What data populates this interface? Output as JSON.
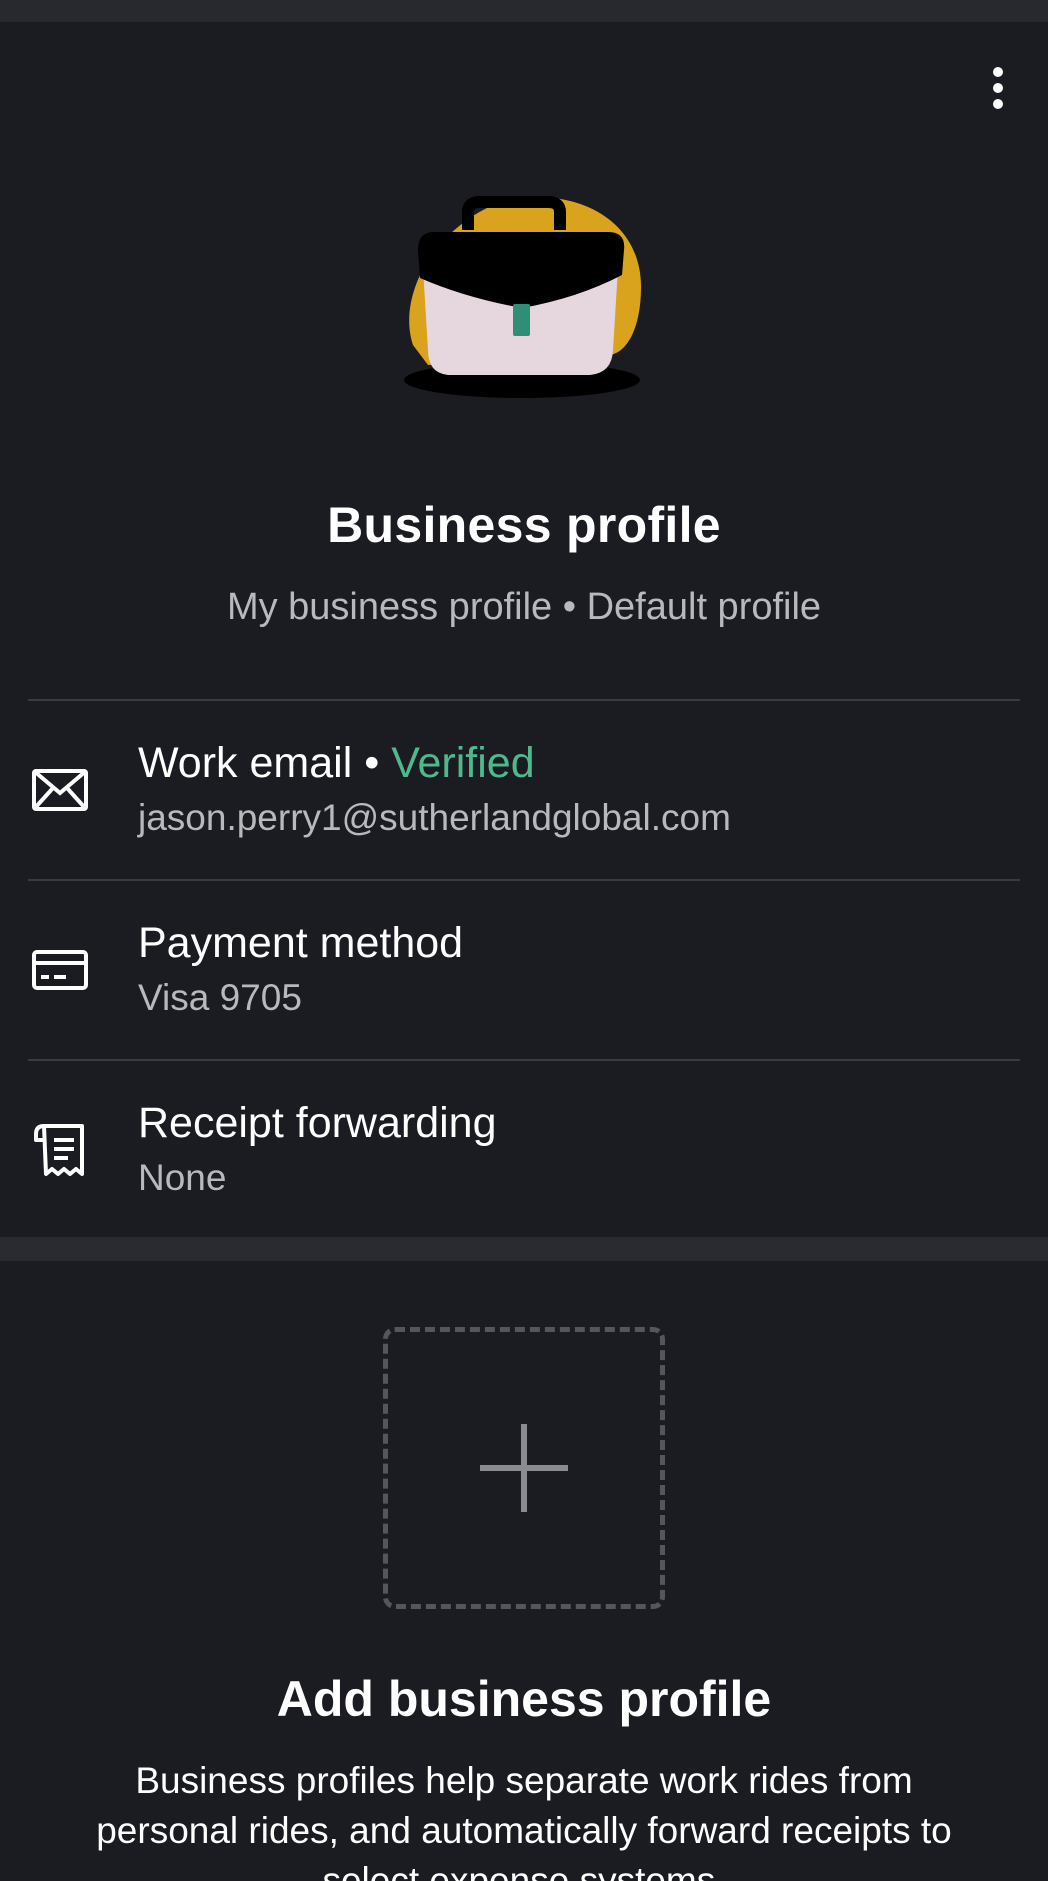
{
  "header": {
    "more_icon": "more-vertical-icon"
  },
  "profile": {
    "illustration": "briefcase-illustration",
    "title": "Business profile",
    "subtitle": "My business profile • Default profile"
  },
  "rows": [
    {
      "icon": "envelope-icon",
      "title": "Work email",
      "separator": " • ",
      "badge": "Verified",
      "value": "jason.perry1@sutherlandglobal.com"
    },
    {
      "icon": "credit-card-icon",
      "title": "Payment method",
      "value": "Visa 9705"
    },
    {
      "icon": "receipt-icon",
      "title": "Receipt forwarding",
      "value": "None"
    }
  ],
  "add_profile": {
    "icon": "plus-icon",
    "title": "Add business profile",
    "description": "Business profiles help separate work rides from personal rides, and automatically forward receipts to select expense systems."
  },
  "colors": {
    "background": "#1b1c21",
    "verified": "#4fb98e",
    "muted_text": "#b8b9bd",
    "briefcase_bg": "#d9a31d",
    "briefcase_clasp": "#2f8f76"
  }
}
